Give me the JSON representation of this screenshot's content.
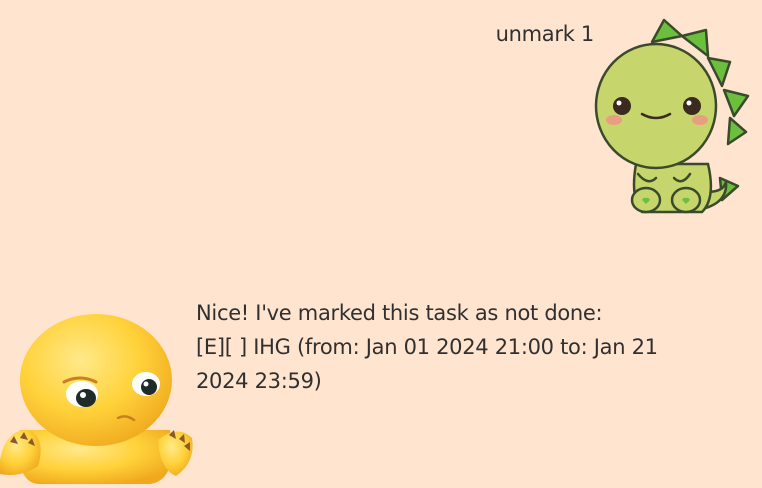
{
  "user_message": {
    "text": "unmark 1",
    "avatar_icon": "green-dinosaur-avatar"
  },
  "bot_message": {
    "lines": [
      "Nice! I've marked this task as not done:",
      "[E][ ] IHG (from: Jan 01 2024 21:00 to: Jan 21",
      "2024 23:59)"
    ],
    "avatar_icon": "yellow-creature-avatar"
  },
  "colors": {
    "background": "#ffe4cf",
    "text": "#303030",
    "dino_body": "#c6d66c",
    "dino_spikes": "#6cbf3d",
    "creature_body": "#ffd23a"
  }
}
